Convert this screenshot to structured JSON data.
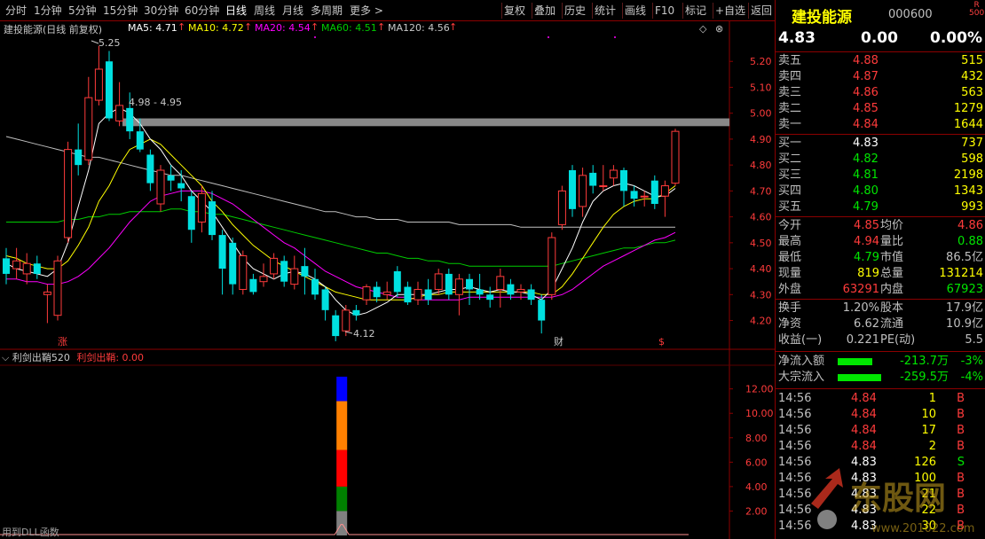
{
  "toolbar": {
    "periods": [
      "分时",
      "1分钟",
      "5分钟",
      "15分钟",
      "30分钟",
      "60分钟",
      "日线",
      "周线",
      "月线",
      "多周期",
      "更多 >"
    ],
    "active_period": "日线",
    "actions": [
      "复权",
      "叠加",
      "历史",
      "统计",
      "画线",
      "F10",
      "标记",
      "+自选",
      "返回"
    ]
  },
  "stock": {
    "name": "建投能源",
    "code": "000600",
    "flag_r": "R",
    "flag_num": "500",
    "price": "4.83",
    "change": "0.00",
    "change_pct": "0.00%"
  },
  "chart_title": {
    "name": "建投能源(日线 前复权)",
    "ma5": "MA5: 4.71",
    "ma10": "MA10: 4.72",
    "ma20": "MA20: 4.54",
    "ma60": "MA60: 4.51",
    "ma120": "MA120: 4.56",
    "arrow": "↑"
  },
  "annotations": {
    "high": "5.25",
    "low": "4.12",
    "band": "4.98 - 4.95",
    "marker1": "涨",
    "marker2": "财",
    "marker3": "$"
  },
  "indicator": {
    "title": "利剑出鞘520",
    "label": "利剑出鞘: 0.00",
    "dll_note": "用到DLL函数"
  },
  "colors": {
    "up": "#ff3b3b",
    "down": "#00e0e0",
    "ma5": "#ffffff",
    "ma10": "#ffff00",
    "ma20": "#ff00ff",
    "ma60": "#00cc00",
    "ma120": "#c0c0c0",
    "band": "#888888"
  },
  "chart_data": {
    "type": "candlestick",
    "y_ticks": [
      "5.20",
      "5.10",
      "5.00",
      "4.90",
      "4.80",
      "4.70",
      "4.60",
      "4.50",
      "4.40",
      "4.30",
      "4.20"
    ],
    "ylim": [
      4.13,
      5.3
    ],
    "candles": [
      [
        4.44,
        4.38,
        4.48,
        4.34
      ],
      [
        4.4,
        4.43,
        4.48,
        4.36
      ],
      [
        4.38,
        4.42,
        4.46,
        4.34
      ],
      [
        4.42,
        4.38,
        4.45,
        4.36
      ],
      [
        4.3,
        4.31,
        4.34,
        4.19
      ],
      [
        4.22,
        4.43,
        4.45,
        4.2
      ],
      [
        4.52,
        4.86,
        4.89,
        4.5
      ],
      [
        4.86,
        4.8,
        4.96,
        4.76
      ],
      [
        4.82,
        5.06,
        5.14,
        4.8
      ],
      [
        5.05,
        5.17,
        5.26,
        5.03
      ],
      [
        5.2,
        4.98,
        5.24,
        4.97
      ],
      [
        4.97,
        5.03,
        5.12,
        4.95
      ],
      [
        5.02,
        4.93,
        5.08,
        4.9
      ],
      [
        4.93,
        4.86,
        4.98,
        4.85
      ],
      [
        4.84,
        4.73,
        4.86,
        4.7
      ],
      [
        4.65,
        4.78,
        4.8,
        4.62
      ],
      [
        4.76,
        4.74,
        4.8,
        4.7
      ],
      [
        4.73,
        4.71,
        4.78,
        4.66
      ],
      [
        4.68,
        4.55,
        4.7,
        4.5
      ],
      [
        4.58,
        4.69,
        4.72,
        4.54
      ],
      [
        4.66,
        4.53,
        4.7,
        4.51
      ],
      [
        4.53,
        4.4,
        4.55,
        4.3
      ],
      [
        4.5,
        4.34,
        4.52,
        4.3
      ],
      [
        4.32,
        4.45,
        4.47,
        4.3
      ],
      [
        4.36,
        4.31,
        4.38,
        4.3
      ],
      [
        4.35,
        4.37,
        4.42,
        4.33
      ],
      [
        4.38,
        4.44,
        4.46,
        4.36
      ],
      [
        4.43,
        4.35,
        4.45,
        4.33
      ],
      [
        4.34,
        4.4,
        4.45,
        4.32
      ],
      [
        4.41,
        4.37,
        4.48,
        4.3
      ],
      [
        4.36,
        4.3,
        4.4,
        4.28
      ],
      [
        4.32,
        4.24,
        4.33,
        4.2
      ],
      [
        4.22,
        4.14,
        4.24,
        4.12
      ],
      [
        4.16,
        4.24,
        4.26,
        4.14
      ],
      [
        4.24,
        4.22,
        4.26,
        4.2
      ],
      [
        4.28,
        4.33,
        4.34,
        4.26
      ],
      [
        4.33,
        4.29,
        4.35,
        4.27
      ],
      [
        4.3,
        4.31,
        4.35,
        4.28
      ],
      [
        4.39,
        4.31,
        4.41,
        4.29
      ],
      [
        4.33,
        4.27,
        4.35,
        4.26
      ],
      [
        4.28,
        4.32,
        4.35,
        4.26
      ],
      [
        4.32,
        4.28,
        4.36,
        4.26
      ],
      [
        4.32,
        4.38,
        4.4,
        4.3
      ],
      [
        4.38,
        4.3,
        4.4,
        4.28
      ],
      [
        4.3,
        4.36,
        4.38,
        4.22
      ],
      [
        4.36,
        4.32,
        4.38,
        4.26
      ],
      [
        4.32,
        4.3,
        4.38,
        4.28
      ],
      [
        4.3,
        4.28,
        4.33,
        4.25
      ],
      [
        4.32,
        4.37,
        4.4,
        4.25
      ],
      [
        4.34,
        4.3,
        4.36,
        4.28
      ],
      [
        4.31,
        4.32,
        4.34,
        4.28
      ],
      [
        4.32,
        4.28,
        4.34,
        4.26
      ],
      [
        4.28,
        4.2,
        4.3,
        4.15
      ],
      [
        4.3,
        4.52,
        4.54,
        4.28
      ],
      [
        4.57,
        4.7,
        4.72,
        4.55
      ],
      [
        4.78,
        4.63,
        4.8,
        4.6
      ],
      [
        4.64,
        4.76,
        4.79,
        4.6
      ],
      [
        4.77,
        4.72,
        4.8,
        4.69
      ],
      [
        4.72,
        4.72,
        4.8,
        4.7
      ],
      [
        4.75,
        4.78,
        4.8,
        4.72
      ],
      [
        4.78,
        4.7,
        4.79,
        4.64
      ],
      [
        4.7,
        4.67,
        4.72,
        4.64
      ],
      [
        4.68,
        4.68,
        4.7,
        4.64
      ],
      [
        4.74,
        4.65,
        4.76,
        4.63
      ],
      [
        4.68,
        4.72,
        4.74,
        4.6
      ],
      [
        4.73,
        4.93,
        4.94,
        4.72
      ]
    ],
    "ma5": [
      4.42,
      4.4,
      4.39,
      4.38,
      4.37,
      4.4,
      4.5,
      4.64,
      4.78,
      4.96,
      5.0,
      5.02,
      5.0,
      4.96,
      4.9,
      4.86,
      4.8,
      4.76,
      4.7,
      4.66,
      4.62,
      4.56,
      4.5,
      4.44,
      4.4,
      4.38,
      4.36,
      4.38,
      4.39,
      4.38,
      4.36,
      4.33,
      4.28,
      4.24,
      4.22,
      4.23,
      4.25,
      4.27,
      4.3,
      4.3,
      4.3,
      4.3,
      4.31,
      4.32,
      4.32,
      4.33,
      4.32,
      4.31,
      4.32,
      4.31,
      4.31,
      4.3,
      4.28,
      4.32,
      4.4,
      4.48,
      4.58,
      4.66,
      4.7,
      4.72,
      4.73,
      4.72,
      4.7,
      4.68,
      4.68,
      4.71
    ],
    "ma10": [
      4.45,
      4.44,
      4.42,
      4.41,
      4.4,
      4.4,
      4.43,
      4.49,
      4.56,
      4.66,
      4.72,
      4.8,
      4.86,
      4.88,
      4.9,
      4.88,
      4.84,
      4.8,
      4.76,
      4.72,
      4.66,
      4.62,
      4.57,
      4.53,
      4.49,
      4.46,
      4.43,
      4.41,
      4.39,
      4.37,
      4.35,
      4.33,
      4.31,
      4.3,
      4.29,
      4.28,
      4.28,
      4.28,
      4.28,
      4.28,
      4.29,
      4.3,
      4.3,
      4.31,
      4.31,
      4.31,
      4.31,
      4.31,
      4.31,
      4.31,
      4.31,
      4.31,
      4.3,
      4.3,
      4.33,
      4.38,
      4.44,
      4.5,
      4.56,
      4.61,
      4.64,
      4.66,
      4.67,
      4.67,
      4.69,
      4.72
    ],
    "ma20": [
      4.36,
      4.36,
      4.35,
      4.35,
      4.34,
      4.34,
      4.35,
      4.37,
      4.4,
      4.44,
      4.48,
      4.53,
      4.58,
      4.62,
      4.66,
      4.68,
      4.69,
      4.7,
      4.7,
      4.7,
      4.69,
      4.67,
      4.65,
      4.62,
      4.59,
      4.56,
      4.53,
      4.5,
      4.48,
      4.45,
      4.42,
      4.39,
      4.37,
      4.35,
      4.33,
      4.32,
      4.31,
      4.3,
      4.29,
      4.29,
      4.28,
      4.28,
      4.28,
      4.28,
      4.28,
      4.29,
      4.29,
      4.29,
      4.29,
      4.29,
      4.29,
      4.29,
      4.29,
      4.29,
      4.3,
      4.32,
      4.35,
      4.38,
      4.41,
      4.43,
      4.45,
      4.47,
      4.49,
      4.51,
      4.52,
      4.54
    ],
    "ma60": [
      4.58,
      4.58,
      4.58,
      4.58,
      4.58,
      4.58,
      4.59,
      4.59,
      4.6,
      4.6,
      4.61,
      4.61,
      4.62,
      4.62,
      4.62,
      4.62,
      4.63,
      4.63,
      4.62,
      4.62,
      4.61,
      4.61,
      4.6,
      4.59,
      4.58,
      4.57,
      4.56,
      4.55,
      4.54,
      4.53,
      4.52,
      4.51,
      4.5,
      4.49,
      4.48,
      4.47,
      4.46,
      4.46,
      4.45,
      4.44,
      4.44,
      4.43,
      4.43,
      4.42,
      4.42,
      4.41,
      4.41,
      4.41,
      4.41,
      4.41,
      4.41,
      4.41,
      4.41,
      4.41,
      4.42,
      4.43,
      4.44,
      4.45,
      4.46,
      4.47,
      4.48,
      4.48,
      4.49,
      4.5,
      4.5,
      4.51
    ],
    "ma120": [
      4.91,
      4.9,
      4.89,
      4.88,
      4.87,
      4.86,
      4.85,
      4.84,
      4.83,
      4.83,
      4.82,
      4.81,
      4.8,
      4.79,
      4.78,
      4.77,
      4.76,
      4.76,
      4.75,
      4.74,
      4.73,
      4.72,
      4.71,
      4.7,
      4.69,
      4.68,
      4.67,
      4.66,
      4.65,
      4.64,
      4.63,
      4.62,
      4.62,
      4.61,
      4.6,
      4.6,
      4.59,
      4.59,
      4.59,
      4.58,
      4.58,
      4.58,
      4.58,
      4.58,
      4.57,
      4.57,
      4.57,
      4.57,
      4.57,
      4.57,
      4.56,
      4.56,
      4.56,
      4.56,
      4.56,
      4.56,
      4.56,
      4.56,
      4.56,
      4.56,
      4.56,
      4.56,
      4.56,
      4.56,
      4.56,
      4.56
    ],
    "indicator_ticks": [
      "12.00",
      "10.00",
      "8.00",
      "6.00",
      "4.00",
      "2.00"
    ],
    "indicator_ylim": [
      0,
      13.5
    ],
    "indicator_value": 0.0,
    "signal_bar": {
      "index": 32,
      "segments": [
        {
          "color": "#808080",
          "to": 2
        },
        {
          "color": "#008000",
          "to": 4
        },
        {
          "color": "#ff0000",
          "to": 7
        },
        {
          "color": "#ff8000",
          "to": 11
        },
        {
          "color": "#0000ff",
          "to": 13
        }
      ]
    }
  },
  "order_book": {
    "asks": [
      {
        "label": "卖五",
        "price": "4.88",
        "vol": "515"
      },
      {
        "label": "卖四",
        "price": "4.87",
        "vol": "432"
      },
      {
        "label": "卖三",
        "price": "4.86",
        "vol": "563"
      },
      {
        "label": "卖二",
        "price": "4.85",
        "vol": "1279"
      },
      {
        "label": "卖一",
        "price": "4.84",
        "vol": "1644"
      }
    ],
    "bids": [
      {
        "label": "买一",
        "price": "4.83",
        "vol": "737",
        "cls": "white"
      },
      {
        "label": "买二",
        "price": "4.82",
        "vol": "598",
        "cls": "green"
      },
      {
        "label": "买三",
        "price": "4.81",
        "vol": "2198",
        "cls": "green"
      },
      {
        "label": "买四",
        "price": "4.80",
        "vol": "1343",
        "cls": "green"
      },
      {
        "label": "买五",
        "price": "4.79",
        "vol": "993",
        "cls": "green"
      }
    ]
  },
  "stats": [
    {
      "l1": "今开",
      "v1": "4.85",
      "c1": "red",
      "l2": "均价",
      "v2": "4.86",
      "c2": "red"
    },
    {
      "l1": "最高",
      "v1": "4.94",
      "c1": "red",
      "l2": "量比",
      "v2": "0.88",
      "c2": "green"
    },
    {
      "l1": "最低",
      "v1": "4.79",
      "c1": "green",
      "l2": "市值",
      "v2": "86.5亿",
      "c2": "lbl"
    },
    {
      "l1": "现量",
      "v1": "819",
      "c1": "yellow",
      "l2": "总量",
      "v2": "131214",
      "c2": "yellow"
    },
    {
      "l1": "外盘",
      "v1": "63291",
      "c1": "red",
      "l2": "内盘",
      "v2": "67923",
      "c2": "green"
    }
  ],
  "stats2": [
    {
      "l1": "换手",
      "v1": "1.20%",
      "l2": "股本",
      "v2": "17.9亿"
    },
    {
      "l1": "净资",
      "v1": "6.62",
      "l2": "流通",
      "v2": "10.9亿"
    },
    {
      "l1": "收益(一)",
      "v1": "0.221",
      "l2": "PE(动)",
      "v2": "5.5"
    }
  ],
  "flows": [
    {
      "label": "净流入额",
      "amount": "-213.7万",
      "pct": "-3%",
      "level": 0.55
    },
    {
      "label": "大宗流入",
      "amount": "-259.5万",
      "pct": "-4%",
      "level": 0.7
    }
  ],
  "ticks": [
    {
      "time": "14:56",
      "price": "4.84",
      "pc": "red",
      "vol": "1",
      "side": "B"
    },
    {
      "time": "14:56",
      "price": "4.84",
      "pc": "red",
      "vol": "10",
      "side": "B"
    },
    {
      "time": "14:56",
      "price": "4.84",
      "pc": "red",
      "vol": "17",
      "side": "B"
    },
    {
      "time": "14:56",
      "price": "4.84",
      "pc": "red",
      "vol": "2",
      "side": "B"
    },
    {
      "time": "14:56",
      "price": "4.83",
      "pc": "white",
      "vol": "126",
      "side": "S"
    },
    {
      "time": "14:56",
      "price": "4.83",
      "pc": "white",
      "vol": "100",
      "side": "B"
    },
    {
      "time": "14:56",
      "price": "4.83",
      "pc": "white",
      "vol": "21",
      "side": "B"
    },
    {
      "time": "14:56",
      "price": "4.83",
      "pc": "white",
      "vol": "22",
      "side": "B"
    },
    {
      "time": "14:56",
      "price": "4.83",
      "pc": "white",
      "vol": "30",
      "side": "B"
    }
  ],
  "watermark": {
    "brand": "东股网",
    "url": "www.201022.com"
  }
}
